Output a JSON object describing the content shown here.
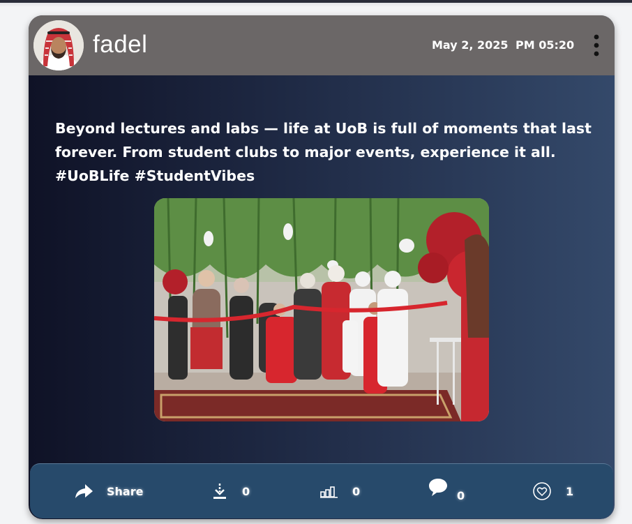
{
  "post": {
    "author": "fadel",
    "date": "May 2, 2025",
    "time": "PM 05:20",
    "text": "Beyond lectures and labs — life at UoB is full of moments that last forever. From student clubs to major events, experience it all. #UoBLife #StudentVibes",
    "image_icon": "event-photo"
  },
  "actions": {
    "share_label": "Share",
    "share_icon": "share-arrow-icon",
    "downloads": "0",
    "download_icon": "download-icon",
    "views": "0",
    "views_icon": "bar-chart-icon",
    "comments": "0",
    "comment_icon": "speech-bubble-icon",
    "likes": "1",
    "like_icon": "heart-icon"
  },
  "colors": {
    "header": "#6b6767",
    "action_bar": "#274a6b",
    "ribbon_red": "#d7262e"
  }
}
